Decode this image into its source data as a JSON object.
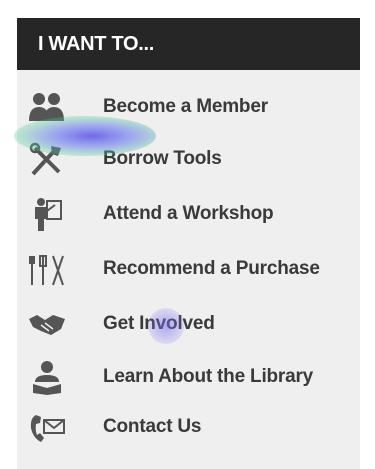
{
  "header": {
    "title": "I WANT TO..."
  },
  "items": [
    {
      "label": "Become a Member",
      "icon": "members-icon"
    },
    {
      "label": "Borrow Tools",
      "icon": "tools-icon"
    },
    {
      "label": "Attend a Workshop",
      "icon": "workshop-icon"
    },
    {
      "label": "Recommend a Purchase",
      "icon": "recommend-tools-icon"
    },
    {
      "label": "Get Involved",
      "icon": "handshake-icon"
    },
    {
      "label": "Learn About the Library",
      "icon": "reader-icon"
    },
    {
      "label": "Contact Us",
      "icon": "phone-mail-icon"
    }
  ],
  "colors": {
    "header_bg": "#262626",
    "panel_bg": "#efefef",
    "text": "#3a3a3a",
    "icon": "#555555"
  }
}
